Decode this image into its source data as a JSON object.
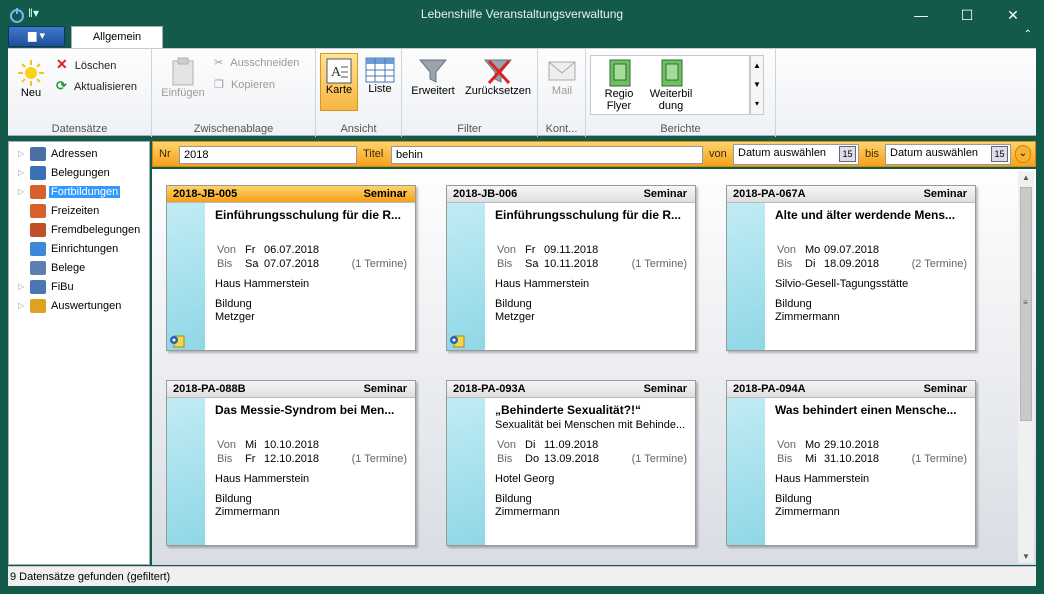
{
  "window": {
    "title": "Lebenshilfe Veranstaltungsverwaltung"
  },
  "ribbon": {
    "tab": "Allgemein",
    "groups": {
      "datensaetze": "Datensätze",
      "zwischenablage": "Zwischenablage",
      "ansicht": "Ansicht",
      "filter": "Filter",
      "kont": "Kont...",
      "berichte": "Berichte"
    },
    "buttons": {
      "neu": "Neu",
      "loeschen": "Löschen",
      "aktualisieren": "Aktualisieren",
      "einfuegen": "Einfügen",
      "ausschneiden": "Ausschneiden",
      "kopieren": "Kopieren",
      "karte": "Karte",
      "liste": "Liste",
      "erweitert": "Erweitert",
      "zuruecksetzen": "Zurücksetzen",
      "mail": "Mail",
      "regio_1": "Regio",
      "regio_2": "Flyer",
      "weiter_1": "Weiterbil",
      "weiter_2": "dung"
    }
  },
  "filterbar": {
    "nr_label": "Nr",
    "nr_value": "2018",
    "titel_label": "Titel",
    "titel_value": "behin",
    "von_label": "von",
    "von_value": "Datum auswählen",
    "bis_label": "bis",
    "bis_value": "Datum auswählen",
    "cal_day": "15"
  },
  "tree": [
    {
      "label": "Adressen",
      "expandable": true
    },
    {
      "label": "Belegungen",
      "expandable": true
    },
    {
      "label": "Fortbildungen",
      "expandable": true,
      "selected": true
    },
    {
      "label": "Freizeiten",
      "expandable": false
    },
    {
      "label": "Fremdbelegungen",
      "expandable": false
    },
    {
      "label": "Einrichtungen",
      "expandable": false
    },
    {
      "label": "Belege",
      "expandable": false
    },
    {
      "label": "FiBu",
      "expandable": true
    },
    {
      "label": "Auswertungen",
      "expandable": true
    }
  ],
  "cards": [
    {
      "id": "2018-JB-005",
      "type": "Seminar",
      "title": "Einführungsschulung für die R...",
      "subtitle": "",
      "von_label": "Von",
      "von_day": "Fr",
      "von_date": "06.07.2018",
      "bis_label": "Bis",
      "bis_day": "Sa",
      "bis_date": "07.07.2018",
      "termine": "(1 Termine)",
      "location": "Haus Hammerstein",
      "category": "Bildung",
      "person": "Metzger",
      "active": true,
      "icon": true
    },
    {
      "id": "2018-JB-006",
      "type": "Seminar",
      "title": "Einführungsschulung für die R...",
      "subtitle": "",
      "von_label": "Von",
      "von_day": "Fr",
      "von_date": "09.11.2018",
      "bis_label": "Bis",
      "bis_day": "Sa",
      "bis_date": "10.11.2018",
      "termine": "(1 Termine)",
      "location": "Haus Hammerstein",
      "category": "Bildung",
      "person": "Metzger",
      "active": false,
      "icon": true
    },
    {
      "id": "2018-PA-067A",
      "type": "Seminar",
      "title": "Alte und älter werdende Mens...",
      "subtitle": "",
      "von_label": "Von",
      "von_day": "Mo",
      "von_date": "09.07.2018",
      "bis_label": "Bis",
      "bis_day": "Di",
      "bis_date": "18.09.2018",
      "termine": "(2 Termine)",
      "location": "Silvio-Gesell-Tagungsstätte",
      "category": "Bildung",
      "person": "Zimmermann",
      "active": false,
      "icon": false
    },
    {
      "id": "2018-PA-088B",
      "type": "Seminar",
      "title": "Das Messie-Syndrom bei Men...",
      "subtitle": "",
      "von_label": "Von",
      "von_day": "Mi",
      "von_date": "10.10.2018",
      "bis_label": "Bis",
      "bis_day": "Fr",
      "bis_date": "12.10.2018",
      "termine": "(1 Termine)",
      "location": "Haus Hammerstein",
      "category": "Bildung",
      "person": "Zimmermann",
      "active": false,
      "icon": false
    },
    {
      "id": "2018-PA-093A",
      "type": "Seminar",
      "title": "„Behinderte Sexualität?!“",
      "subtitle": "Sexualität bei Menschen mit Behinde...",
      "von_label": "Von",
      "von_day": "Di",
      "von_date": "11.09.2018",
      "bis_label": "Bis",
      "bis_day": "Do",
      "bis_date": "13.09.2018",
      "termine": "(1 Termine)",
      "location": "Hotel Georg",
      "category": "Bildung",
      "person": "Zimmermann",
      "active": false,
      "icon": false
    },
    {
      "id": "2018-PA-094A",
      "type": "Seminar",
      "title": "Was behindert einen Mensche...",
      "subtitle": "",
      "von_label": "Von",
      "von_day": "Mo",
      "von_date": "29.10.2018",
      "bis_label": "Bis",
      "bis_day": "Mi",
      "bis_date": "31.10.2018",
      "termine": "(1 Termine)",
      "location": "Haus Hammerstein",
      "category": "Bildung",
      "person": "Zimmermann",
      "active": false,
      "icon": false
    }
  ],
  "status": "9 Datensätze gefunden (gefiltert)",
  "colors": {
    "titlebar": "#145a4b",
    "accent": "#f7a11a",
    "selection": "#3399ff",
    "card_strip": "#a9e3ee"
  }
}
